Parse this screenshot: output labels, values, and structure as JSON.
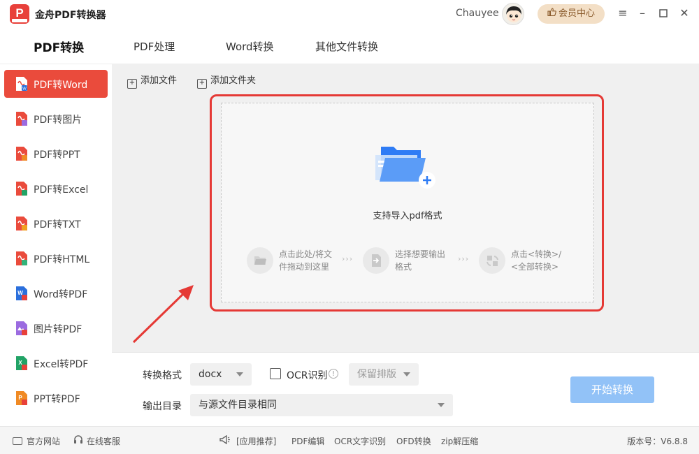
{
  "app": {
    "title": "金舟PDF转换器",
    "user": "Chauyee",
    "vip_label": "会员中心"
  },
  "topnav": {
    "tabs": [
      "PDF转换",
      "PDF处理",
      "Word转换",
      "其他文件转换"
    ]
  },
  "sidebar": {
    "items": [
      {
        "label": "PDF转Word",
        "badge_color": "#2b6fdc",
        "active": true
      },
      {
        "label": "PDF转图片",
        "badge_color": "#9b6be0"
      },
      {
        "label": "PDF转PPT",
        "badge_color": "#f08a24"
      },
      {
        "label": "PDF转Excel",
        "badge_color": "#21a366"
      },
      {
        "label": "PDF转TXT",
        "badge_color": "#f0a020"
      },
      {
        "label": "PDF转HTML",
        "badge_color": "#32b37a"
      },
      {
        "label": "Word转PDF",
        "badge_color": "#e8403a"
      },
      {
        "label": "图片转PDF",
        "badge_color": "#e8403a"
      },
      {
        "label": "Excel转PDF",
        "badge_color": "#e8403a"
      },
      {
        "label": "PPT转PDF",
        "badge_color": "#e8403a"
      }
    ]
  },
  "toolbar": {
    "add_file": "添加文件",
    "add_folder": "添加文件夹"
  },
  "dropzone": {
    "hint": "支持导入pdf格式",
    "steps": [
      {
        "line1": "点击此处/将文",
        "line2": "件拖动到这里"
      },
      {
        "line1": "选择想要输出",
        "line2": "格式"
      },
      {
        "line1": "点击<转换>/",
        "line2": "<全部转换>"
      }
    ],
    "arrow_glyph": "›››"
  },
  "options": {
    "format_label": "转换格式",
    "format_value": "docx",
    "ocr_label": "OCR识别",
    "layout_value": "保留排版",
    "output_label": "输出目录",
    "output_value": "与源文件目录相同",
    "start_button": "开始转换"
  },
  "footer": {
    "website": "官方网站",
    "support": "在线客服",
    "recommend": "[应用推荐]",
    "links": [
      "PDF编辑",
      "OCR文字识别",
      "OFD转换",
      "zip解压缩"
    ],
    "version": "版本号：V6.8.8"
  },
  "colors": {
    "accent_red": "#e53935",
    "sidebar_active": "#ea4b3c",
    "start_button": "#92c2f7",
    "vip": "#f3dfc6"
  }
}
